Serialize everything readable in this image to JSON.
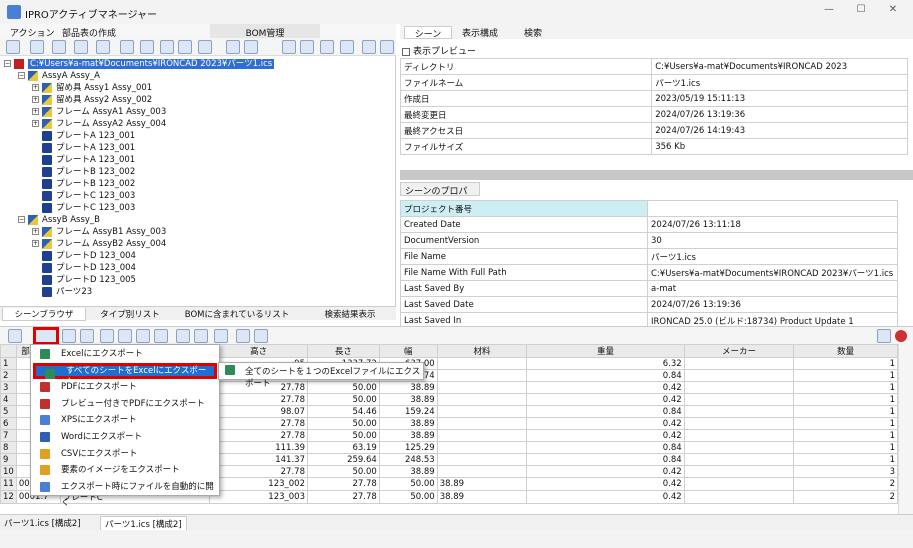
{
  "app": {
    "title": "IPROアクティブマネージャー",
    "min": "—",
    "max": "☐",
    "close": "✕"
  },
  "menu": {
    "action": "アクション",
    "bom_create": "部品表の作成",
    "bom_manage": "BOM管理"
  },
  "tree": {
    "root": "C:¥Users¥a-mat¥Documents¥IRONCAD 2023¥パーツ1.ics",
    "rows": [
      "AssyA Assy_A",
      "留め具 Assy1 Assy_001",
      "留め具 Assy2 Assy_002",
      "フレーム AssyA1 Assy_003",
      "フレーム AssyA2 Assy_004",
      "プレートA 123_001",
      "プレートA 123_001",
      "プレートA 123_001",
      "プレートB 123_002",
      "プレートB 123_002",
      "プレートC 123_003",
      "プレートC 123_003",
      "AssyB Assy_B",
      "フレーム AssyB1 Assy_003",
      "フレーム AssyB2 Assy_004",
      "プレートD 123_004",
      "プレートD 123_004",
      "プレートD 123_005",
      "パーツ23"
    ],
    "tabs": [
      "シーンブラウザ",
      "タイプ別リスト",
      "BOMに含まれているリスト",
      "検索結果表示"
    ]
  },
  "right": {
    "tabs": [
      "シーン",
      "表示構成",
      "検索"
    ],
    "preview": "表示プレビュー",
    "props": [
      [
        "ディレクトリ",
        "C:¥Users¥a-mat¥Documents¥IRONCAD 2023"
      ],
      [
        "ファイルネーム",
        "パーツ1.ics"
      ],
      [
        "作成日",
        "2023/05/19 15:11:13"
      ],
      [
        "最終変更日",
        "2024/07/26 13:19:36"
      ],
      [
        "最終アクセス日",
        "2024/07/26 14:19:43"
      ],
      [
        "ファイルサイズ",
        "356 Kb"
      ]
    ],
    "scene_props_tab": "シーンのプロパティ",
    "scene_props": [
      [
        "プロジェクト番号",
        ""
      ],
      [
        "Created Date",
        "2024/07/26 13:11:18"
      ],
      [
        "DocumentVersion",
        "30"
      ],
      [
        "File Name",
        "パーツ1.ics"
      ],
      [
        "File Name With Full Path",
        "C:¥Users¥a-mat¥Documents¥IRONCAD 2023¥パーツ1.ics"
      ],
      [
        "Last Saved By",
        "a-mat"
      ],
      [
        "Last Saved Date",
        "2024/07/26 13:19:36"
      ],
      [
        "Last Saved In",
        "IRONCAD 25.0 (ビルド:18734) Product Update 1"
      ]
    ]
  },
  "grid": {
    "headers": [
      "",
      "部品番号",
      "説明",
      "高さ",
      "長さ",
      "幅",
      "材料",
      "重量",
      "メーカー",
      "数量"
    ],
    "rows": [
      [
        "1",
        "",
        "",
        ".95",
        "1337.72",
        "637.00",
        "",
        "6.32",
        "",
        "1"
      ],
      [
        "2",
        "",
        "",
        "77.45",
        "83.69",
        "150.74",
        "",
        "0.84",
        "",
        "1"
      ],
      [
        "3",
        "",
        "001",
        "27.78",
        "50.00",
        "38.89",
        "",
        "0.42",
        "",
        "1"
      ],
      [
        "4",
        "",
        "001",
        "27.78",
        "50.00",
        "38.89",
        "",
        "0.42",
        "",
        "1"
      ],
      [
        "5",
        "",
        "sy_002",
        "98.07",
        "54.46",
        "159.24",
        "",
        "0.84",
        "",
        "1"
      ],
      [
        "6",
        "",
        "001",
        "27.78",
        "50.00",
        "38.89",
        "",
        "0.42",
        "",
        "1"
      ],
      [
        "7",
        "",
        "001",
        "27.78",
        "50.00",
        "38.89",
        "",
        "0.42",
        "",
        "1"
      ],
      [
        "8",
        "",
        "sy_003",
        "111.39",
        "63.19",
        "125.29",
        "",
        "0.84",
        "",
        "1"
      ],
      [
        "9",
        "",
        "sy_004",
        "141.37",
        "259.64",
        "248.53",
        "",
        "0.84",
        "",
        "1"
      ],
      [
        "10",
        "",
        "3_001",
        "27.78",
        "50.00",
        "38.89",
        "",
        "0.42",
        "",
        "3"
      ],
      [
        "11",
        "0001.6",
        "プレートB",
        "123_002",
        "27.78",
        "50.00",
        "38.89",
        "0.42",
        "",
        "2"
      ],
      [
        "12",
        "0001.7",
        "プレートC",
        "123_003",
        "27.78",
        "50.00",
        "38.89",
        "0.42",
        "",
        "2"
      ]
    ]
  },
  "context_menu": {
    "items": [
      "Excelにエクスポート",
      "すべてのシートをExcelにエクスポート",
      "PDFにエクスポート",
      "プレビュー付きでPDFにエクスポート",
      "XPSにエクスポート",
      "Wordにエクスポート",
      "CSVにエクスポート",
      "要素のイメージをエクスポート",
      "エクスポート時にファイルを自動的に開く"
    ],
    "submenu": "全てのシートを１つのExcelファイルにエクスポート"
  },
  "bottom_tabs": [
    "パーツ1.ics [構成2]",
    "パーツ1.ics [構成2]"
  ]
}
